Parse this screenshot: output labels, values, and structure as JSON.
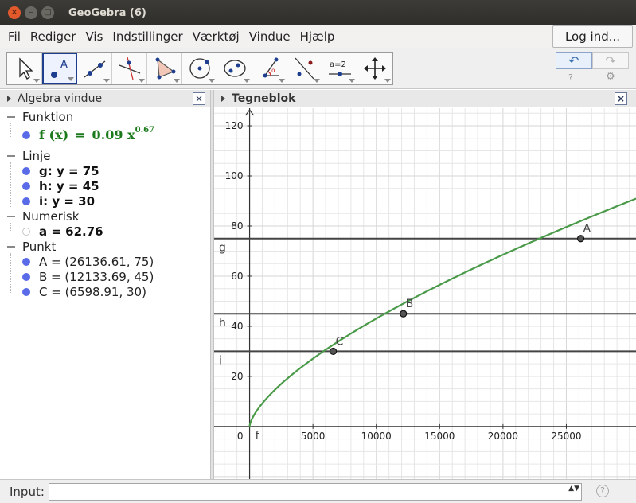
{
  "window": {
    "title": "GeoGebra (6)",
    "close_glyph": "×",
    "minimize_glyph": "–",
    "maximize_glyph": "□"
  },
  "menu": {
    "items": [
      "Fil",
      "Rediger",
      "Vis",
      "Indstillinger",
      "Værktøj",
      "Vindue",
      "Hjælp"
    ],
    "login": "Log ind..."
  },
  "toolbar": {
    "tools": [
      "move-tool-icon",
      "point-tool-icon",
      "line-tool-icon",
      "perpendicular-tool-icon",
      "polygon-tool-icon",
      "circle-tool-icon",
      "ellipse-tool-icon",
      "angle-tool-icon",
      "reflect-tool-icon",
      "slider-tool-icon",
      "move-graphics-tool-icon"
    ],
    "selected_tool": "point-tool-icon",
    "point_tool_label": "A",
    "slider_tool_label": "a=2",
    "undo_glyph": "↶",
    "redo_glyph": "↷",
    "help_glyph": "?",
    "settings_glyph": "⚙"
  },
  "algebra": {
    "title": "Algebra vindue",
    "close_glyph": "×",
    "categories": {
      "function": "Funktion",
      "line": "Linje",
      "numeric": "Numerisk",
      "point": "Punkt"
    },
    "function": {
      "lhs": "f (x)",
      "eq": "=",
      "coef": "0.09 x",
      "exp": "0.67"
    },
    "lines": [
      "g: y = 75",
      "h: y = 45",
      "i: y = 30"
    ],
    "numeric": [
      "a = 62.76"
    ],
    "points": [
      "A = (26136.61, 75)",
      "B = (12133.69, 45)",
      "C = (6598.91, 30)"
    ]
  },
  "graphics": {
    "title": "Tegneblok",
    "close_glyph": "×",
    "function_label": "f",
    "line_labels": [
      "g",
      "h",
      "i"
    ],
    "point_labels": [
      "A",
      "B",
      "C"
    ],
    "origin_label": "0",
    "y_tick_labels": [
      "20",
      "40",
      "60",
      "80",
      "100",
      "120"
    ],
    "x_tick_labels": [
      "5000",
      "10000",
      "15000",
      "20000",
      "25000"
    ],
    "colors": {
      "curve": "#4a9a4a",
      "hlines": "#444444",
      "grid": "#e6e6e6",
      "point_fill": "#555555"
    }
  },
  "input": {
    "label": "Input:",
    "value": "",
    "help_glyph": "?",
    "history_glyph": "▲▼"
  },
  "chart_data": {
    "type": "line",
    "title": "",
    "xlabel": "",
    "ylabel": "",
    "xlim": [
      -2800,
      30500
    ],
    "ylim": [
      -21,
      127
    ],
    "function": {
      "name": "f",
      "coef": 0.09,
      "exp": 0.67
    },
    "horizontal_lines": [
      {
        "name": "g",
        "y": 75
      },
      {
        "name": "h",
        "y": 45
      },
      {
        "name": "i",
        "y": 30
      }
    ],
    "points": [
      {
        "name": "A",
        "x": 26136.61,
        "y": 75
      },
      {
        "name": "B",
        "x": 12133.69,
        "y": 45
      },
      {
        "name": "C",
        "x": 6598.91,
        "y": 30
      }
    ],
    "x_ticks": [
      5000,
      10000,
      15000,
      20000,
      25000
    ],
    "y_ticks": [
      20,
      40,
      60,
      80,
      100,
      120
    ],
    "grid": true
  }
}
